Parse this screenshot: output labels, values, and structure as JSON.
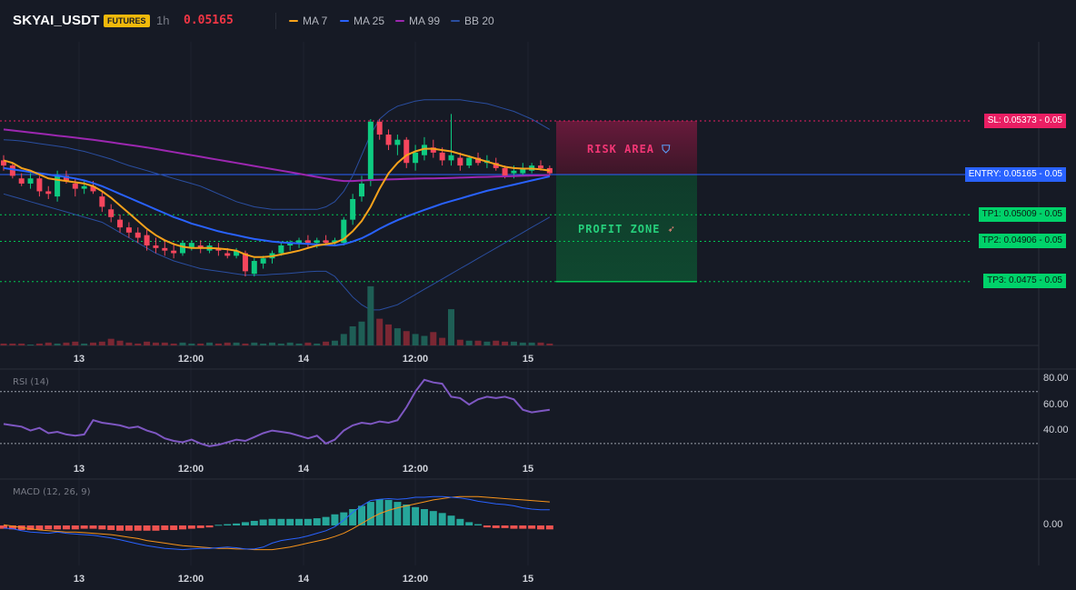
{
  "header": {
    "symbol": "SKYAI_USDT",
    "market_badge": "FUTURES",
    "timeframe": "1h",
    "last_price": "0.05165",
    "indicators": [
      {
        "label": "MA 7",
        "color": "#f7a21b"
      },
      {
        "label": "MA 25",
        "color": "#2962ff"
      },
      {
        "label": "MA 99",
        "color": "#9c27b0"
      },
      {
        "label": "BB 20",
        "color": "#2a4ea0"
      }
    ]
  },
  "colors": {
    "up": "#26a69a",
    "up_bright": "#0ecb81",
    "down": "#f6465d",
    "risk": "#e91e63",
    "entry": "#2962ff",
    "profit": "#00c853"
  },
  "trade": {
    "risk_label": "RISK AREA",
    "risk_icon": "shield-icon",
    "profit_label": "PROFIT ZONE",
    "profit_icon": "rocket-icon",
    "levels": [
      {
        "id": "sl",
        "label": "SL: 0.05373",
        "value": "0.05",
        "price": 0.05373
      },
      {
        "id": "entry",
        "label": "ENTRY: 0.05165",
        "value": "0.05",
        "price": 0.05165
      },
      {
        "id": "tp1",
        "label": "TP1: 0.05009",
        "value": "0.05",
        "price": 0.05009
      },
      {
        "id": "tp2",
        "label": "TP2: 0.04906",
        "value": "0.05",
        "price": 0.04906
      },
      {
        "id": "tp3",
        "label": "TP3: 0.0475",
        "value": "0.05",
        "price": 0.0475
      }
    ]
  },
  "x_axis": {
    "labels": [
      "13",
      "12:00",
      "14",
      "12:00",
      "15"
    ]
  },
  "rsi": {
    "title": "RSI (14)",
    "ticks": [
      "80.00",
      "60.00",
      "40.00"
    ],
    "bands": [
      70,
      30
    ]
  },
  "macd": {
    "title": "MACD (12, 26, 9)",
    "ticks": [
      "0.00"
    ]
  },
  "chart_data": [
    {
      "type": "candlestick",
      "title": "SKYAI_USDT 1h",
      "x": [
        "13",
        "12:00",
        "14",
        "12:00",
        "15"
      ],
      "ylim": [
        0.0468,
        0.055
      ],
      "candles": [
        [
          0.0522,
          0.0524,
          0.0518,
          0.052
        ],
        [
          0.052,
          0.0521,
          0.0515,
          0.0516
        ],
        [
          0.0515,
          0.0517,
          0.0512,
          0.0513
        ],
        [
          0.0513,
          0.0517,
          0.0511,
          0.0515
        ],
        [
          0.0515,
          0.0516,
          0.0508,
          0.051
        ],
        [
          0.051,
          0.0512,
          0.0507,
          0.0509
        ],
        [
          0.0508,
          0.0518,
          0.0506,
          0.0516
        ],
        [
          0.0516,
          0.0518,
          0.0513,
          0.0514
        ],
        [
          0.0513,
          0.0515,
          0.0508,
          0.0511
        ],
        [
          0.0511,
          0.0514,
          0.0509,
          0.0512
        ],
        [
          0.0512,
          0.0514,
          0.0509,
          0.051
        ],
        [
          0.0508,
          0.051,
          0.0502,
          0.0504
        ],
        [
          0.0503,
          0.0505,
          0.0498,
          0.05
        ],
        [
          0.0499,
          0.0501,
          0.0494,
          0.0496
        ],
        [
          0.0496,
          0.0498,
          0.0492,
          0.0494
        ],
        [
          0.0494,
          0.0496,
          0.049,
          0.0492
        ],
        [
          0.0493,
          0.0495,
          0.0487,
          0.0489
        ],
        [
          0.0489,
          0.0492,
          0.0486,
          0.0488
        ],
        [
          0.0488,
          0.0491,
          0.0485,
          0.0487
        ],
        [
          0.0487,
          0.049,
          0.0484,
          0.0486
        ],
        [
          0.0486,
          0.0491,
          0.0485,
          0.049
        ],
        [
          0.0488,
          0.0491,
          0.0487,
          0.049
        ],
        [
          0.0489,
          0.0491,
          0.0486,
          0.0488
        ],
        [
          0.0487,
          0.049,
          0.0486,
          0.0489
        ],
        [
          0.0488,
          0.049,
          0.0485,
          0.0487
        ],
        [
          0.0486,
          0.0488,
          0.0484,
          0.0485
        ],
        [
          0.0485,
          0.0488,
          0.0484,
          0.0487
        ],
        [
          0.0486,
          0.0487,
          0.0477,
          0.0479
        ],
        [
          0.0478,
          0.0484,
          0.0477,
          0.0483
        ],
        [
          0.0482,
          0.0485,
          0.048,
          0.0484
        ],
        [
          0.0484,
          0.0487,
          0.0482,
          0.0486
        ],
        [
          0.0486,
          0.049,
          0.0485,
          0.0489
        ],
        [
          0.0489,
          0.0491,
          0.0487,
          0.049
        ],
        [
          0.049,
          0.0492,
          0.0488,
          0.0491
        ],
        [
          0.0491,
          0.0493,
          0.0488,
          0.049
        ],
        [
          0.049,
          0.0492,
          0.0488,
          0.0491
        ],
        [
          0.0491,
          0.0493,
          0.0489,
          0.049
        ],
        [
          0.049,
          0.0492,
          0.0489,
          0.0491
        ],
        [
          0.049,
          0.05,
          0.0489,
          0.0499
        ],
        [
          0.0499,
          0.0509,
          0.0497,
          0.0507
        ],
        [
          0.0508,
          0.0516,
          0.0506,
          0.0513
        ],
        [
          0.0514,
          0.0538,
          0.0512,
          0.0537
        ],
        [
          0.0537,
          0.0538,
          0.053,
          0.0532
        ],
        [
          0.0532,
          0.0534,
          0.0526,
          0.0528
        ],
        [
          0.0528,
          0.0532,
          0.0524,
          0.053
        ],
        [
          0.053,
          0.0531,
          0.0519,
          0.0521
        ],
        [
          0.0521,
          0.0528,
          0.0518,
          0.0525
        ],
        [
          0.0524,
          0.0531,
          0.0522,
          0.0528
        ],
        [
          0.0527,
          0.053,
          0.0523,
          0.0525
        ],
        [
          0.0525,
          0.0527,
          0.052,
          0.0522
        ],
        [
          0.0522,
          0.054,
          0.052,
          0.0524
        ],
        [
          0.0523,
          0.0525,
          0.0518,
          0.052
        ],
        [
          0.052,
          0.0524,
          0.0519,
          0.0523
        ],
        [
          0.0523,
          0.0525,
          0.052,
          0.0521
        ],
        [
          0.0521,
          0.0524,
          0.0519,
          0.0522
        ],
        [
          0.0521,
          0.0523,
          0.0518,
          0.0519
        ],
        [
          0.0519,
          0.052,
          0.0515,
          0.0516
        ],
        [
          0.0517,
          0.052,
          0.0515,
          0.0518
        ],
        [
          0.0517,
          0.0521,
          0.0516,
          0.0519
        ],
        [
          0.0518,
          0.0521,
          0.0517,
          0.052
        ],
        [
          0.052,
          0.0522,
          0.0518,
          0.0519
        ],
        [
          0.0519,
          0.052,
          0.0516,
          0.0517
        ]
      ],
      "ma7": [
        0.0522,
        0.0521,
        0.0519,
        0.0518,
        0.05165,
        0.0515,
        0.05145,
        0.0514,
        0.05135,
        0.0513,
        0.0512,
        0.051,
        0.05075,
        0.05045,
        0.05015,
        0.04985,
        0.04955,
        0.0493,
        0.0491,
        0.04895,
        0.04885,
        0.0488,
        0.0488,
        0.0488,
        0.04878,
        0.04875,
        0.0487,
        0.04855,
        0.04845,
        0.04845,
        0.04848,
        0.04855,
        0.04862,
        0.0487,
        0.0488,
        0.0489,
        0.04895,
        0.049,
        0.04915,
        0.04945,
        0.04985,
        0.0504,
        0.0511,
        0.0517,
        0.0521,
        0.0524,
        0.05255,
        0.05265,
        0.05265,
        0.0526,
        0.05255,
        0.05245,
        0.05235,
        0.05225,
        0.05215,
        0.05205,
        0.05195,
        0.0519,
        0.05188,
        0.05188,
        0.05185,
        0.0518
      ],
      "ma25": [
        0.0519,
        0.05185,
        0.0518,
        0.05175,
        0.0517,
        0.05165,
        0.0516,
        0.05155,
        0.0515,
        0.05142,
        0.05132,
        0.0512,
        0.05105,
        0.0509,
        0.05075,
        0.0506,
        0.05045,
        0.0503,
        0.05015,
        0.05,
        0.04988,
        0.04975,
        0.04965,
        0.04955,
        0.04945,
        0.04937,
        0.0493,
        0.04922,
        0.04915,
        0.0491,
        0.04905,
        0.04902,
        0.049,
        0.04898,
        0.04896,
        0.04894,
        0.04892,
        0.0489,
        0.04895,
        0.04905,
        0.04918,
        0.04935,
        0.04955,
        0.04972,
        0.04988,
        0.05002,
        0.05015,
        0.05028,
        0.0504,
        0.05052,
        0.05062,
        0.05072,
        0.05082,
        0.05092,
        0.05102,
        0.0511,
        0.05118,
        0.05126,
        0.05134,
        0.05142,
        0.0515,
        0.05158
      ],
      "ma99": [
        0.0534,
        0.05336,
        0.05332,
        0.05328,
        0.05324,
        0.0532,
        0.05316,
        0.05312,
        0.05308,
        0.05304,
        0.053,
        0.05295,
        0.0529,
        0.05285,
        0.0528,
        0.05275,
        0.0527,
        0.05264,
        0.05258,
        0.05252,
        0.05246,
        0.0524,
        0.05234,
        0.05228,
        0.05222,
        0.05216,
        0.0521,
        0.05204,
        0.05198,
        0.05192,
        0.05186,
        0.0518,
        0.05174,
        0.05168,
        0.05162,
        0.05156,
        0.0515,
        0.05144,
        0.0514,
        0.0514,
        0.05142,
        0.05144,
        0.05145,
        0.05146,
        0.05147,
        0.05148,
        0.05149,
        0.0515,
        0.0515,
        0.05151,
        0.05152,
        0.05153,
        0.05154,
        0.05155,
        0.05156,
        0.05157,
        0.05158,
        0.05159,
        0.0516,
        0.05161,
        0.05162,
        0.05163
      ],
      "bb_upper": [
        0.053,
        0.05298,
        0.05295,
        0.0529,
        0.05285,
        0.0528,
        0.05275,
        0.0527,
        0.05262,
        0.05255,
        0.05245,
        0.05235,
        0.05225,
        0.05212,
        0.052,
        0.0519,
        0.0518,
        0.0517,
        0.0516,
        0.0515,
        0.0514,
        0.0513,
        0.0512,
        0.05105,
        0.0509,
        0.05075,
        0.0506,
        0.0505,
        0.0504,
        0.05035,
        0.0503,
        0.0503,
        0.0503,
        0.0503,
        0.0503,
        0.0503,
        0.0504,
        0.0506,
        0.051,
        0.0516,
        0.0524,
        0.0532,
        0.0538,
        0.0541,
        0.0543,
        0.0544,
        0.0545,
        0.05455,
        0.05455,
        0.05455,
        0.05455,
        0.05455,
        0.0545,
        0.05445,
        0.0544,
        0.0543,
        0.0542,
        0.0541,
        0.05395,
        0.0538,
        0.0536,
        0.0534
      ],
      "bb_lower": [
        0.0509,
        0.0508,
        0.0507,
        0.0506,
        0.0505,
        0.0504,
        0.0503,
        0.0502,
        0.0501,
        0.05,
        0.0499,
        0.0498,
        0.0496,
        0.0494,
        0.0492,
        0.049,
        0.0488,
        0.0486,
        0.04845,
        0.0483,
        0.0482,
        0.0481,
        0.048,
        0.04795,
        0.0479,
        0.04785,
        0.0478,
        0.04775,
        0.04775,
        0.04775,
        0.04778,
        0.0478,
        0.04782,
        0.04785,
        0.04788,
        0.0479,
        0.0479,
        0.0477,
        0.0473,
        0.0469,
        0.0466,
        0.0464,
        0.0464,
        0.0465,
        0.0466,
        0.0468,
        0.047,
        0.0472,
        0.0474,
        0.0476,
        0.0478,
        0.048,
        0.0482,
        0.0484,
        0.0486,
        0.0488,
        0.049,
        0.0492,
        0.0494,
        0.0496,
        0.0498,
        0.05
      ],
      "volume": [
        2,
        2,
        2,
        1,
        2,
        3,
        2,
        3,
        4,
        2,
        3,
        4,
        7,
        5,
        3,
        2,
        4,
        3,
        3,
        2,
        3,
        2,
        2,
        3,
        2,
        3,
        3,
        2,
        3,
        2,
        3,
        2,
        3,
        2,
        3,
        2,
        4,
        5,
        12,
        20,
        25,
        62,
        28,
        22,
        18,
        15,
        12,
        10,
        14,
        8,
        38,
        6,
        5,
        5,
        4,
        5,
        4,
        4,
        3,
        3,
        3,
        2
      ]
    },
    {
      "type": "line",
      "title": "RSI (14)",
      "ylim": [
        20,
        85
      ],
      "values": [
        45,
        44,
        43,
        40,
        42,
        38,
        39,
        37,
        36,
        37,
        48,
        46,
        45,
        44,
        42,
        43,
        40,
        38,
        34,
        32,
        31,
        33,
        30,
        28,
        29,
        31,
        33,
        32,
        35,
        38,
        40,
        39,
        38,
        36,
        34,
        36,
        30,
        33,
        40,
        44,
        46,
        45,
        47,
        46,
        48,
        58,
        70,
        79,
        77,
        76,
        66,
        65,
        60,
        64,
        66,
        65,
        66,
        64,
        56,
        54,
        55,
        56
      ]
    },
    {
      "type": "bar+line",
      "title": "MACD (12, 26, 9)",
      "ylim": [
        -0.0005,
        0.0005
      ],
      "histogram": [
        -5e-05,
        -6e-05,
        -7e-05,
        -7e-05,
        -7e-05,
        -6e-05,
        -6e-05,
        -6e-05,
        -6e-05,
        -5e-05,
        -5e-05,
        -6e-05,
        -7e-05,
        -8e-05,
        -8e-05,
        -8e-05,
        -8e-05,
        -8e-05,
        -7e-05,
        -7e-05,
        -6e-05,
        -5e-05,
        -4e-05,
        -3e-05,
        1e-05,
        2e-05,
        3e-05,
        5e-05,
        7e-05,
        9e-05,
        0.0001,
        0.0001,
        0.0001,
        0.0001,
        0.0001,
        0.00011,
        0.00013,
        0.00017,
        0.0002,
        0.00025,
        0.0003,
        0.00036,
        0.0004,
        0.00039,
        0.00036,
        0.00032,
        0.00028,
        0.00025,
        0.00022,
        0.00019,
        0.00015,
        0.0001,
        5e-05,
        2e-05,
        -3e-05,
        -4e-05,
        -4e-05,
        -5e-05,
        -5e-05,
        -5e-05,
        -6e-05,
        -6e-05
      ],
      "macd": [
        -4e-05,
        -5e-05,
        -8e-05,
        -0.0001,
        -0.00011,
        -0.00012,
        -0.0001,
        -0.00012,
        -0.00013,
        -0.00014,
        -0.00015,
        -0.00017,
        -0.00019,
        -0.00022,
        -0.00025,
        -0.00028,
        -0.00031,
        -0.00033,
        -0.00035,
        -0.00036,
        -0.00037,
        -0.00036,
        -0.00035,
        -0.00035,
        -0.00034,
        -0.00033,
        -0.00034,
        -0.00036,
        -0.00036,
        -0.00033,
        -0.00027,
        -0.00023,
        -0.00021,
        -0.00019,
        -0.00016,
        -0.00012,
        -8e-05,
        -2e-05,
        8e-05,
        0.0002,
        0.0003,
        0.00038,
        0.0004,
        0.00041,
        0.0004,
        0.00041,
        0.00043,
        0.00043,
        0.00044,
        0.00044,
        0.00043,
        0.00042,
        0.0004,
        0.00037,
        0.00035,
        0.00033,
        0.00032,
        0.0003,
        0.00027,
        0.00025,
        0.00024,
        0.00024
      ],
      "signal": [
        1e-05,
        -1e-05,
        -3e-05,
        -5e-05,
        -7e-05,
        -8e-05,
        -9e-05,
        -0.0001,
        -0.0001,
        -0.00011,
        -0.00012,
        -0.00013,
        -0.00014,
        -0.00016,
        -0.00018,
        -0.0002,
        -0.00023,
        -0.00025,
        -0.00027,
        -0.00029,
        -0.00031,
        -0.00032,
        -0.00033,
        -0.00034,
        -0.00035,
        -0.00035,
        -0.00036,
        -0.00036,
        -0.00037,
        -0.00037,
        -0.00037,
        -0.00035,
        -0.00033,
        -0.0003,
        -0.00027,
        -0.00024,
        -0.00021,
        -0.00017,
        -0.00012,
        -5e-05,
        3e-05,
        0.00011,
        0.00018,
        0.00023,
        0.00027,
        0.0003,
        0.00033,
        0.00036,
        0.00039,
        0.00041,
        0.00043,
        0.00044,
        0.00044,
        0.00044,
        0.00043,
        0.00042,
        0.00041,
        0.0004,
        0.00039,
        0.00038,
        0.00037,
        0.00036
      ]
    }
  ]
}
